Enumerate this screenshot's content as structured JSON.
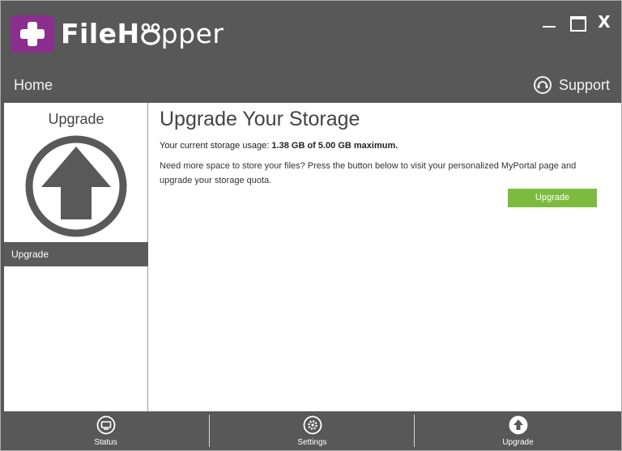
{
  "app": {
    "brand_part1": "FileH",
    "brand_part2": "pper"
  },
  "window_controls": {
    "close_label": "X"
  },
  "navbar": {
    "home_label": "Home",
    "support_label": "Support"
  },
  "sidebar": {
    "title": "Upgrade",
    "active_item_label": "Upgrade"
  },
  "main": {
    "title": "Upgrade Your Storage",
    "usage_prefix": "Your current storage usage:",
    "usage_value": "1.38 GB of 5.00 GB maximum.",
    "description": "Need more space to store your files? Press the button below to visit your personalized MyPortal page and upgrade your storage quota.",
    "upgrade_button_label": "Upgrade"
  },
  "footer": {
    "items": [
      {
        "label": "Status",
        "icon": "status-icon"
      },
      {
        "label": "Settings",
        "icon": "gear-icon"
      },
      {
        "label": "Upgrade",
        "icon": "upload-arrow-icon"
      }
    ]
  },
  "colors": {
    "chrome": "#585858",
    "brand_purple": "#8a2f8f",
    "accent_green": "#7dbb3e"
  }
}
